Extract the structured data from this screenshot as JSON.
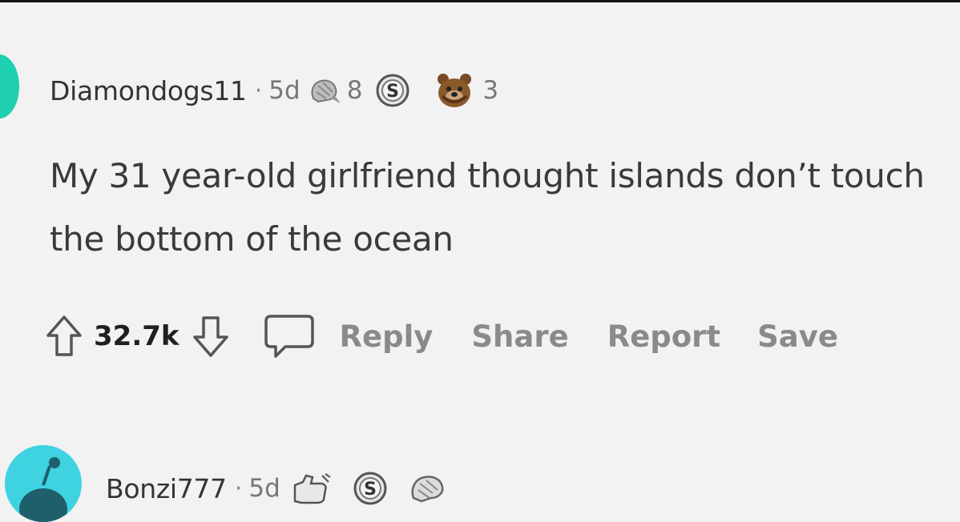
{
  "comment1": {
    "username": "Diamondogs11",
    "separator": "·",
    "age": "5d",
    "awards": [
      {
        "icon": "silver-award-icon",
        "count": "8"
      },
      {
        "icon": "s-coin-award-icon",
        "count": ""
      },
      {
        "icon": "bear-award-icon",
        "count": "3"
      }
    ],
    "text": "My 31 year-old girlfriend thought islands don’t touch the bottom of the ocean",
    "score": "32.7k",
    "actions": {
      "reply": "Reply",
      "share": "Share",
      "report": "Report",
      "save": "Save"
    },
    "colors": {
      "avatar": "#1ecfb0"
    }
  },
  "comment2": {
    "username": "Bonzi777",
    "separator": "·",
    "age": "5d",
    "awards": [
      {
        "icon": "helpful-award-icon"
      },
      {
        "icon": "s-coin-award-icon"
      },
      {
        "icon": "silver-award-icon"
      }
    ],
    "colors": {
      "avatar": "#3fd3e1"
    }
  }
}
